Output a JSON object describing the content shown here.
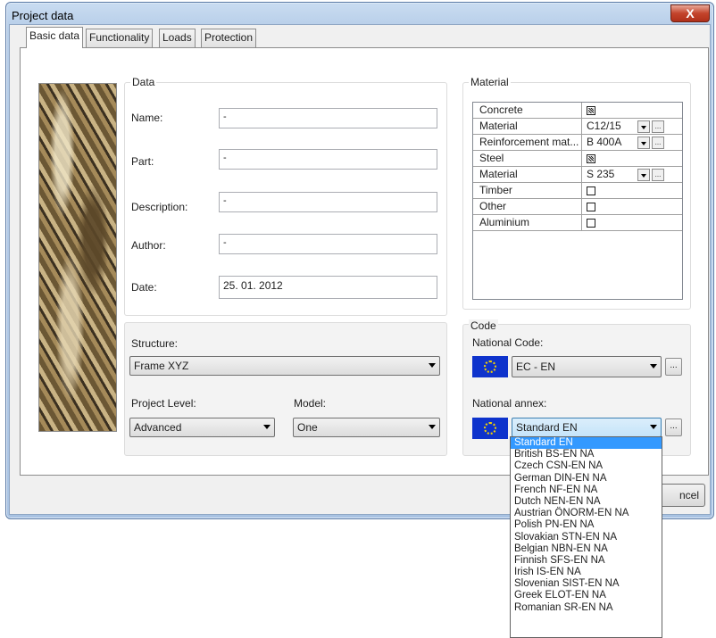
{
  "window": {
    "title": "Project data",
    "close_glyph": "X"
  },
  "tabs": [
    "Basic data",
    "Functionality",
    "Loads",
    "Protection"
  ],
  "data_group": {
    "legend": "Data",
    "name_label": "Name:",
    "name_value": "-",
    "part_label": "Part:",
    "part_value": "-",
    "description_label": "Description:",
    "description_value": "-",
    "author_label": "Author:",
    "author_value": "-",
    "date_label": "Date:",
    "date_value": "25. 01. 2012"
  },
  "structure_group": {
    "structure_label": "Structure:",
    "structure_value": "Frame XYZ",
    "project_level_label": "Project Level:",
    "project_level_value": "Advanced",
    "model_label": "Model:",
    "model_value": "One"
  },
  "material_group": {
    "legend": "Material",
    "rows": [
      {
        "name": "Concrete",
        "type": "check",
        "checked": true
      },
      {
        "name": "Material",
        "type": "combo",
        "value": "C12/15"
      },
      {
        "name": "Reinforcement mat...",
        "type": "combo",
        "value": "B 400A"
      },
      {
        "name": "Steel",
        "type": "check",
        "checked": true
      },
      {
        "name": "Material",
        "type": "combo",
        "value": "S 235"
      },
      {
        "name": "Timber",
        "type": "check",
        "checked": false
      },
      {
        "name": "Other",
        "type": "check",
        "checked": false
      },
      {
        "name": "Aluminium",
        "type": "check",
        "checked": false
      }
    ]
  },
  "code_group": {
    "legend": "Code",
    "national_code_label": "National Code:",
    "national_code_value": "EC - EN",
    "national_annex_label": "National annex:",
    "national_annex_value": "Standard EN",
    "browse_label": "..."
  },
  "annex_dropdown": {
    "options": [
      "Standard EN",
      "British BS-EN NA",
      "Czech CSN-EN NA",
      "German DIN-EN NA",
      "French NF-EN NA",
      "Dutch NEN-EN NA",
      "Austrian ÖNORM-EN NA",
      "Polish PN-EN NA",
      "Slovakian STN-EN NA",
      "Belgian NBN-EN NA",
      "Finnish SFS-EN NA",
      "Irish IS-EN NA",
      "Slovenian SIST-EN NA",
      "Greek ELOT-EN NA",
      "Romanian SR-EN NA"
    ],
    "selected": "Standard EN"
  },
  "footer": {
    "cancel_label_visible": "ncel"
  },
  "colors": {
    "flag_blue": "#0e33cc",
    "selection": "#3399ff"
  },
  "icons": [
    "close-icon",
    "dropdown-arrow-icon",
    "eu-flag-icon",
    "checkbox-icon"
  ]
}
